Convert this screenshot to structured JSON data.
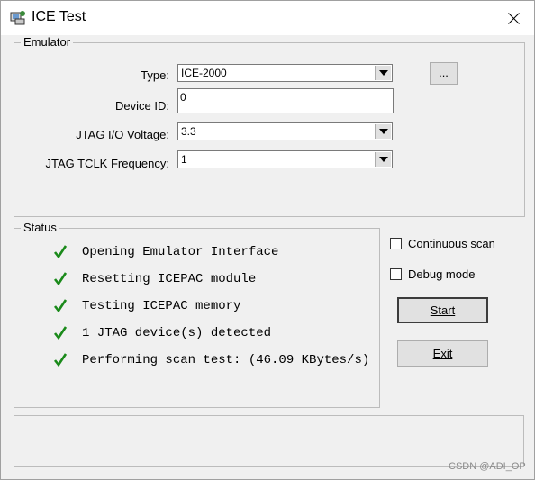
{
  "window": {
    "title": "ICE Test"
  },
  "emulator": {
    "group_label": "Emulator",
    "type_label": "Type:",
    "type_value": "ICE-2000",
    "device_id_label": "Device ID:",
    "device_id_value": "0",
    "jtag_voltage_label": "JTAG I/O Voltage:",
    "jtag_voltage_value": "3.3",
    "tclk_label": "JTAG TCLK Frequency:",
    "tclk_value": "1",
    "browse_label": "..."
  },
  "status": {
    "group_label": "Status",
    "items": [
      "Opening Emulator Interface",
      "Resetting ICEPAC module",
      "Testing ICEPAC memory",
      "1 JTAG device(s) detected",
      "Performing scan test: (46.09 KBytes/s)"
    ]
  },
  "options": {
    "continuous_scan_label": "Continuous scan",
    "debug_mode_label": "Debug mode"
  },
  "buttons": {
    "start_label": "Start",
    "exit_label": "Exit"
  },
  "watermark": "CSDN @ADI_OP",
  "colors": {
    "check": "#1a8a1a",
    "window_bg": "#f0f0f0",
    "titlebar_bg": "#ffffff"
  }
}
